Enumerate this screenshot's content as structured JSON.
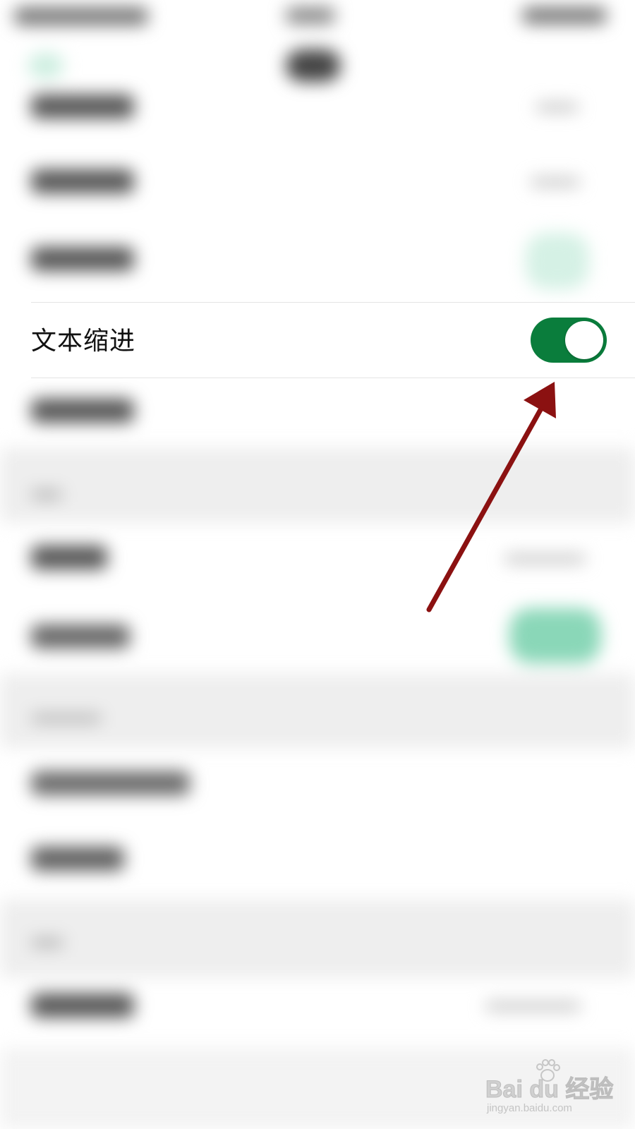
{
  "setting_row": {
    "label": "文本缩进",
    "toggle_state": "on"
  },
  "colors": {
    "toggle_on": "#0a7d3c",
    "arrow": "#8b1111",
    "blurred_accent": "#8ad7b8"
  },
  "watermark": {
    "logo": "Bai du 经验",
    "url": "jingyan.baidu.com"
  }
}
